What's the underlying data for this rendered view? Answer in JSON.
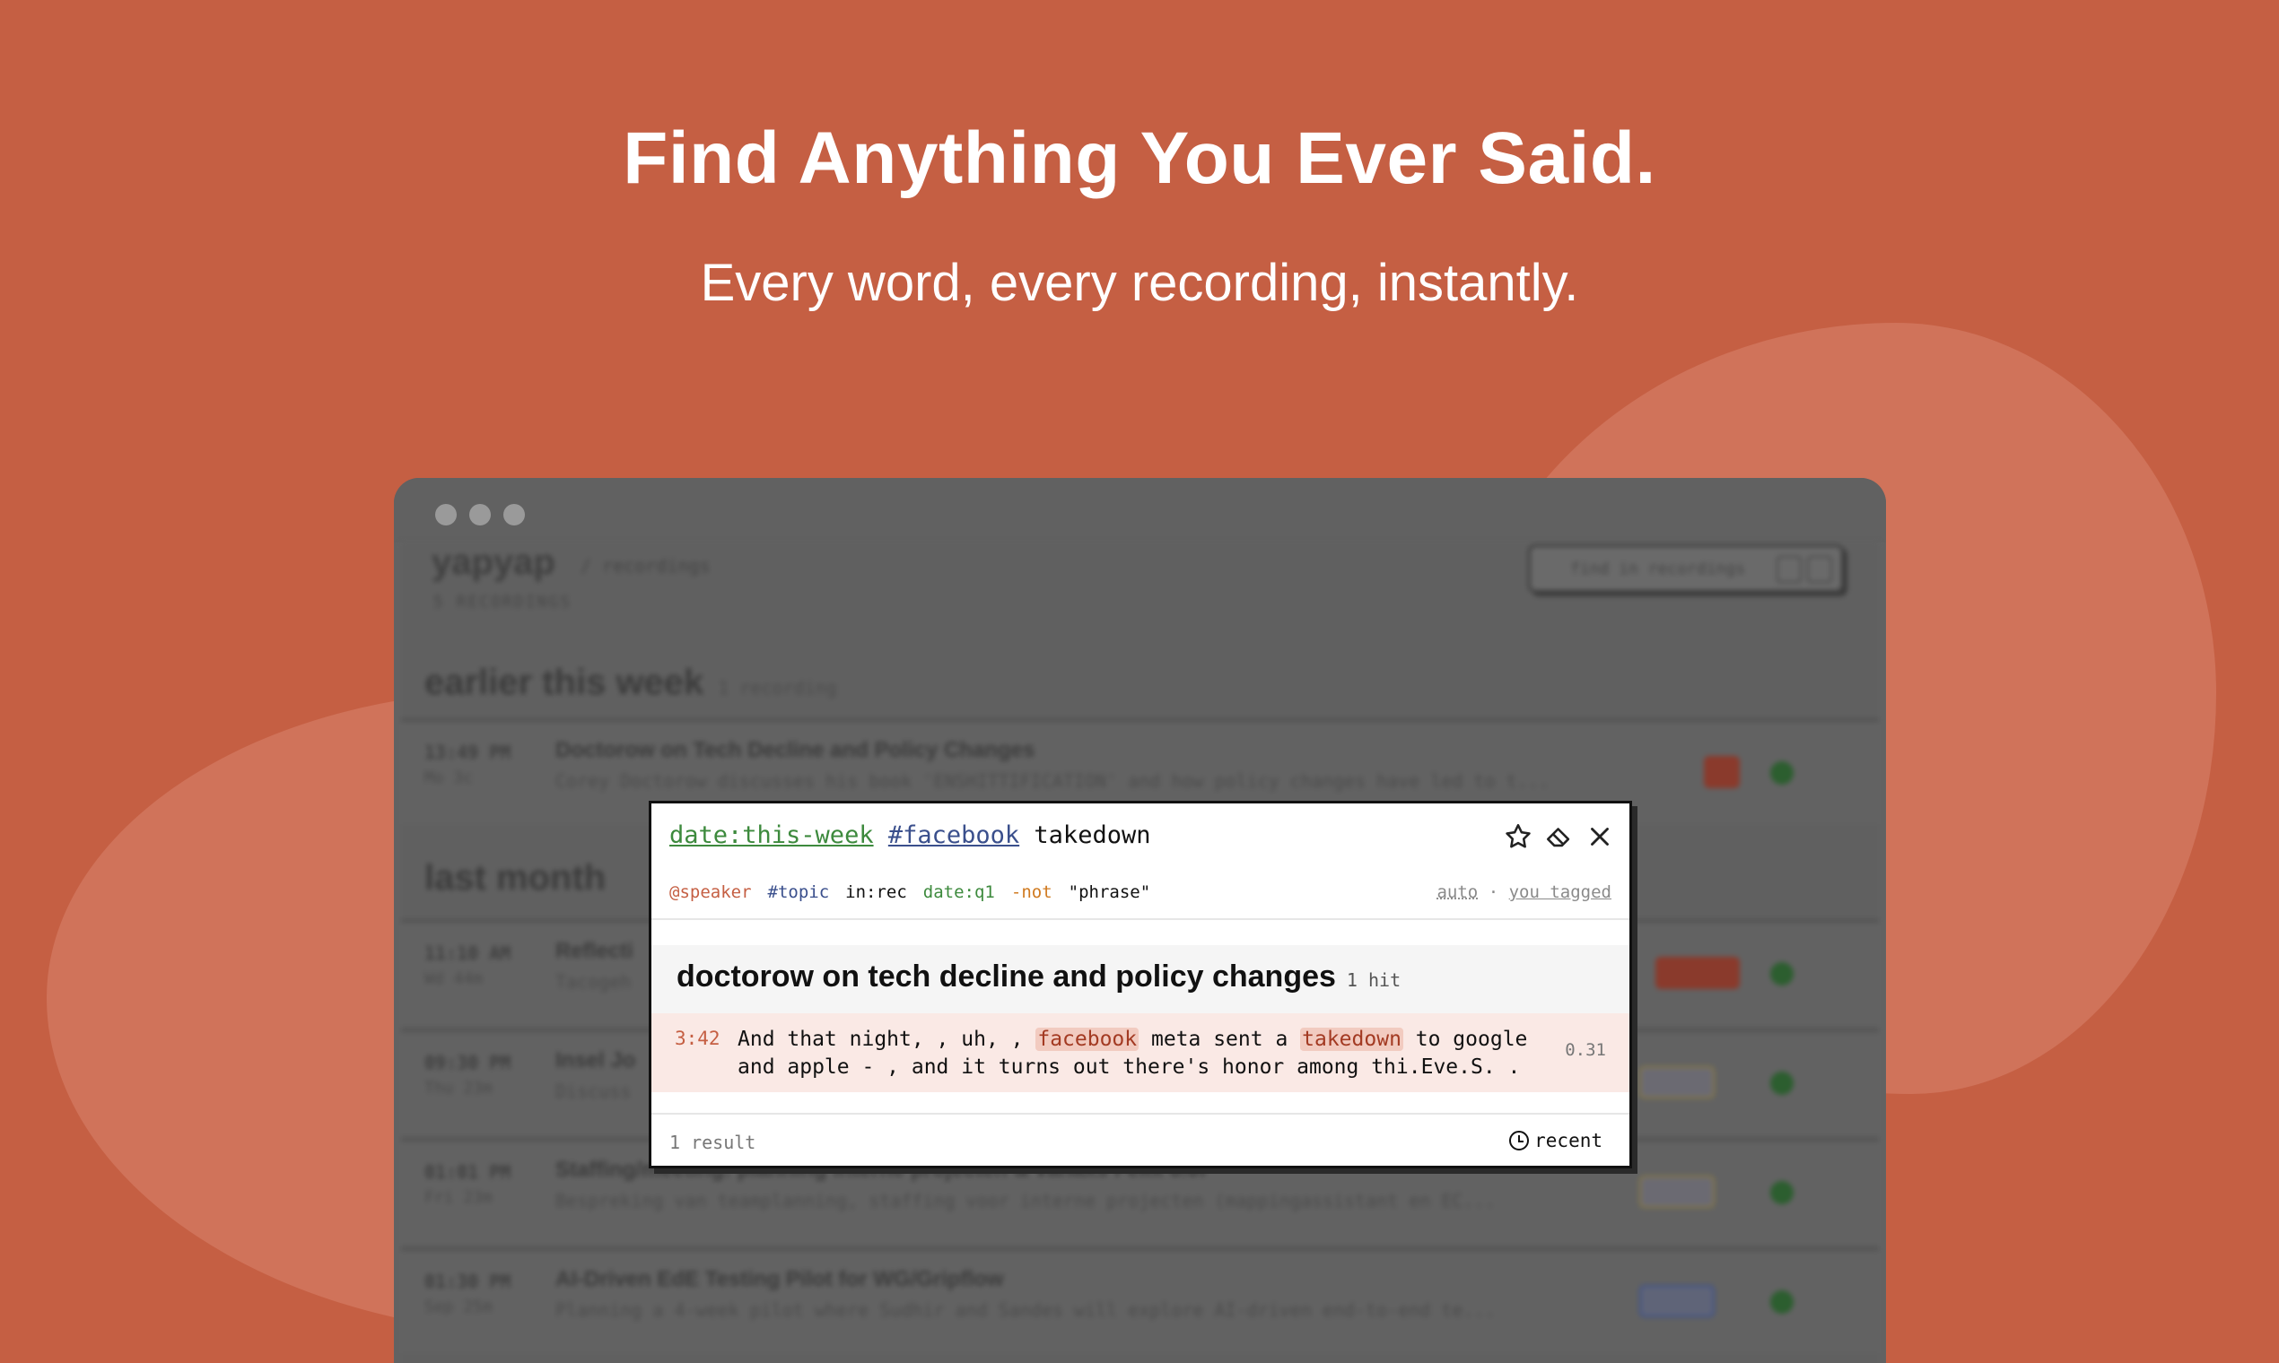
{
  "hero": {
    "title": "Find Anything You Ever Said.",
    "subtitle": "Every word, every recording, instantly."
  },
  "app": {
    "logo": "yapyap",
    "breadcrumb": "/ recordings",
    "recordings_count": "5 RECORDINGS",
    "find_placeholder": "find in recordings"
  },
  "sections": [
    {
      "label": "earlier this week",
      "count": "1 recording"
    },
    {
      "label": "last month"
    }
  ],
  "rows": [
    {
      "time": "13:49 PM",
      "date": "Mo 3c",
      "title": "Doctorow on Tech Decline and Policy Changes",
      "snippet": "Corey Doctorow discusses his book 'ENSHITTIFICATION' and how policy changes have led to t..."
    },
    {
      "time": "11:10 AM",
      "date": "Wd 44m",
      "title": "Reflecti",
      "snippet": "Tacogeh"
    },
    {
      "time": "09:30 PM",
      "date": "Thu 23m",
      "title": "Insel Jo",
      "snippet": "Discuss"
    },
    {
      "time": "01:01 PM",
      "date": "Fri 23m",
      "title": "Staffing/meeting: planning interne projecten & vanaxs Felix 6.0f",
      "snippet": "Bespreking van teamplanning, staffing voor interne projecten (mappingassistant en EC..."
    },
    {
      "time": "01:30 PM",
      "date": "Sep 25m",
      "title": "AI-Driven EdE Testing Pilot for WG/Gripflow",
      "snippet": "Planning a 4-week pilot where Sudhir and Sandes will explore AI-driven end-to-end te..."
    }
  ],
  "search": {
    "query_date": "date:this-week",
    "query_tag": "#facebook",
    "query_text": "takedown",
    "hints": {
      "speaker": "@speaker",
      "topic": "#topic",
      "in": "in:rec",
      "date": "date:q1",
      "not": "-not",
      "phrase": "\"phrase\""
    },
    "filter_auto": "auto",
    "filter_sep": "·",
    "filter_tagged": "you tagged",
    "result_title": "doctorow on tech decline and policy changes",
    "result_hits": "1 hit",
    "match": {
      "time": "3:42",
      "before": "And that night, , uh, , ",
      "hl1": "facebook",
      "middle": " meta sent a ",
      "hl2": "takedown",
      "after": " to google and apple - , and it turns out there's honor among thi.Eve.S. .",
      "score": "0.31"
    },
    "result_count": "1 result",
    "sort": "recent"
  },
  "icons": {
    "star": "star-icon",
    "eraser": "eraser-icon",
    "close": "close-icon",
    "clock": "clock-icon"
  },
  "colors": {
    "background": "#c55f43",
    "accent_green": "#3d8a3d",
    "accent_blue": "#3a4f8c",
    "highlight": "#f2cbc0"
  }
}
